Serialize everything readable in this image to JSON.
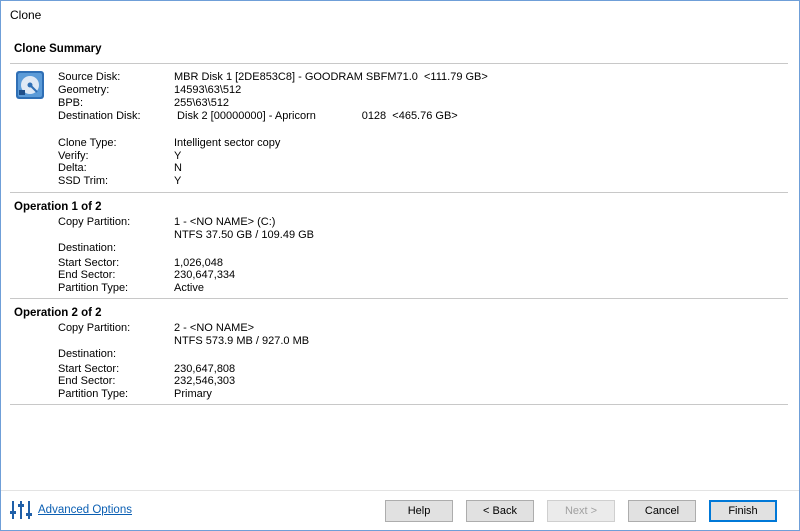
{
  "window": {
    "title": "Clone"
  },
  "summary": {
    "heading": "Clone Summary",
    "icon": "disk-icon",
    "rows": [
      {
        "label": "Source Disk:",
        "value": "MBR Disk 1 [2DE853C8] - GOODRAM SBFM71.0  <111.79 GB>"
      },
      {
        "label": "Geometry:",
        "value": "14593\\63\\512"
      },
      {
        "label": "BPB:",
        "value": "255\\63\\512"
      },
      {
        "label": "Destination Disk:",
        "value": " Disk 2 [00000000] - Apricorn               0128  <465.76 GB>"
      }
    ],
    "options": [
      {
        "label": "Clone Type:",
        "value": "Intelligent sector copy"
      },
      {
        "label": "Verify:",
        "value": "Y"
      },
      {
        "label": "Delta:",
        "value": "N"
      },
      {
        "label": "SSD Trim:",
        "value": "Y"
      }
    ]
  },
  "operations": [
    {
      "heading": "Operation 1 of 2",
      "copy_partition_label": "Copy Partition:",
      "copy_partition_line1": "1 - <NO NAME> (C:)",
      "copy_partition_line2": "NTFS 37.50 GB / 109.49 GB",
      "destination_label": "Destination:",
      "start_label": "Start Sector:",
      "start_value": "1,026,048",
      "end_label": "End Sector:",
      "end_value": "230,647,334",
      "type_label": "Partition Type:",
      "type_value": "Active"
    },
    {
      "heading": "Operation 2 of 2",
      "copy_partition_label": "Copy Partition:",
      "copy_partition_line1": "2 - <NO NAME>",
      "copy_partition_line2": "NTFS 573.9 MB / 927.0 MB",
      "destination_label": "Destination:",
      "start_label": "Start Sector:",
      "start_value": "230,647,808",
      "end_label": "End Sector:",
      "end_value": "232,546,303",
      "type_label": "Partition Type:",
      "type_value": "Primary"
    }
  ],
  "footer": {
    "advanced_icon": "sliders-icon",
    "advanced_label": "Advanced Options",
    "help": "Help",
    "back": "< Back",
    "next": "Next >",
    "cancel": "Cancel",
    "finish": "Finish"
  }
}
